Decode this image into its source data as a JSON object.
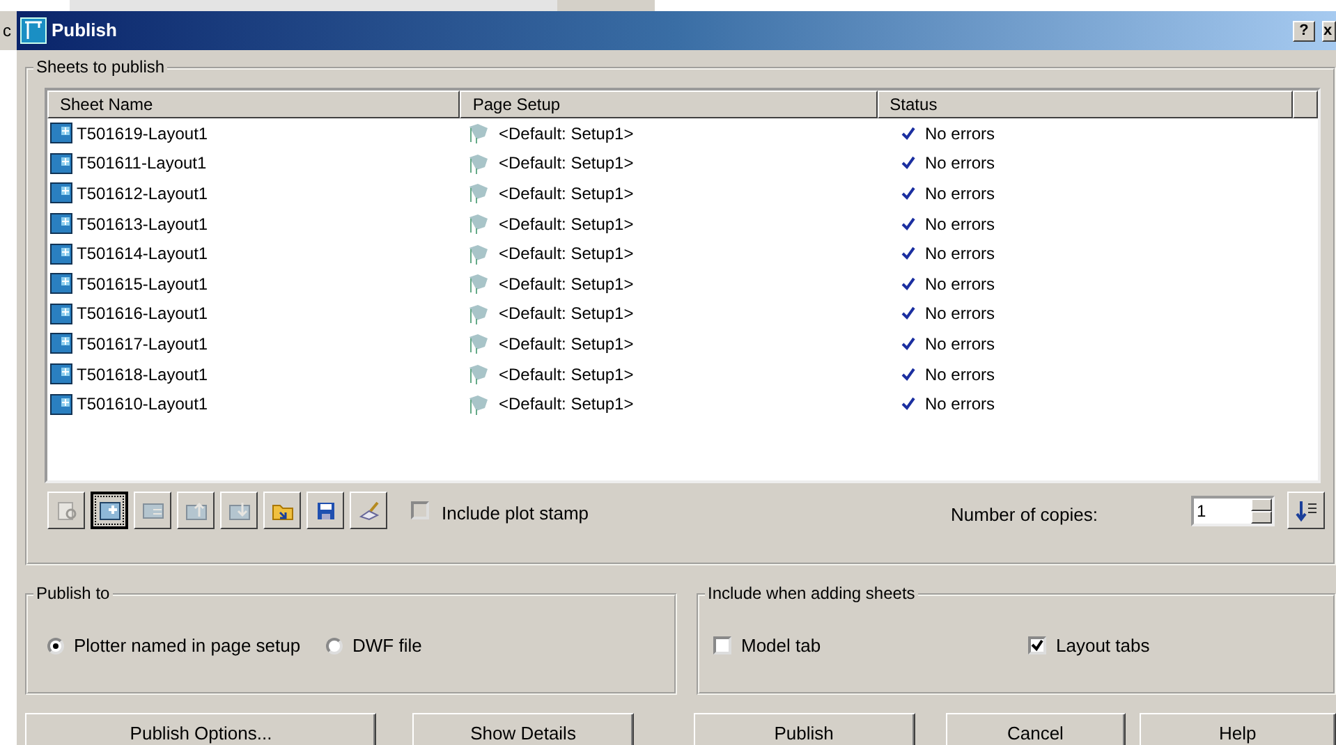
{
  "behind_text": "c",
  "window": {
    "title": "Publish",
    "help_button": "?",
    "close_button": "x"
  },
  "sheets_group": {
    "label": "Sheets to publish",
    "columns": [
      "Sheet Name",
      "Page Setup",
      "Status"
    ],
    "rows": [
      {
        "name": "T501619-Layout1",
        "page_setup": "<Default: Setup1>",
        "status": "No errors"
      },
      {
        "name": "T501611-Layout1",
        "page_setup": "<Default: Setup1>",
        "status": "No errors"
      },
      {
        "name": "T501612-Layout1",
        "page_setup": "<Default: Setup1>",
        "status": "No errors"
      },
      {
        "name": "T501613-Layout1",
        "page_setup": "<Default: Setup1>",
        "status": "No errors"
      },
      {
        "name": "T501614-Layout1",
        "page_setup": "<Default: Setup1>",
        "status": "No errors"
      },
      {
        "name": "T501615-Layout1",
        "page_setup": "<Default: Setup1>",
        "status": "No errors"
      },
      {
        "name": "T501616-Layout1",
        "page_setup": "<Default: Setup1>",
        "status": "No errors"
      },
      {
        "name": "T501617-Layout1",
        "page_setup": "<Default: Setup1>",
        "status": "No errors"
      },
      {
        "name": "T501618-Layout1",
        "page_setup": "<Default: Setup1>",
        "status": "No errors"
      },
      {
        "name": "T501610-Layout1",
        "page_setup": "<Default: Setup1>",
        "status": "No errors"
      }
    ],
    "toolbar": [
      {
        "kind": "preview",
        "disabled": true,
        "selected": false
      },
      {
        "kind": "add",
        "disabled": false,
        "selected": true
      },
      {
        "kind": "remove",
        "disabled": true,
        "selected": false
      },
      {
        "kind": "up",
        "disabled": true,
        "selected": false
      },
      {
        "kind": "down",
        "disabled": true,
        "selected": false
      },
      {
        "kind": "open",
        "disabled": false,
        "selected": false
      },
      {
        "kind": "save",
        "disabled": false,
        "selected": false
      },
      {
        "kind": "stamp",
        "disabled": false,
        "selected": false
      }
    ],
    "plot_stamp": {
      "label": "Include plot stamp",
      "checked": false,
      "disabled": true
    },
    "copies": {
      "label": "Number of copies:",
      "value": "1"
    }
  },
  "publish_to": {
    "label": "Publish to",
    "options": [
      {
        "label": "Plotter named in page setup",
        "selected": true
      },
      {
        "label": "DWF file",
        "selected": false
      }
    ]
  },
  "include_group": {
    "label": "Include when adding sheets",
    "options": [
      {
        "label": "Model tab",
        "checked": false
      },
      {
        "label": "Layout tabs",
        "checked": true
      }
    ]
  },
  "buttons": [
    "Publish Options...",
    "Show Details",
    "Publish",
    "Cancel",
    "Help"
  ]
}
